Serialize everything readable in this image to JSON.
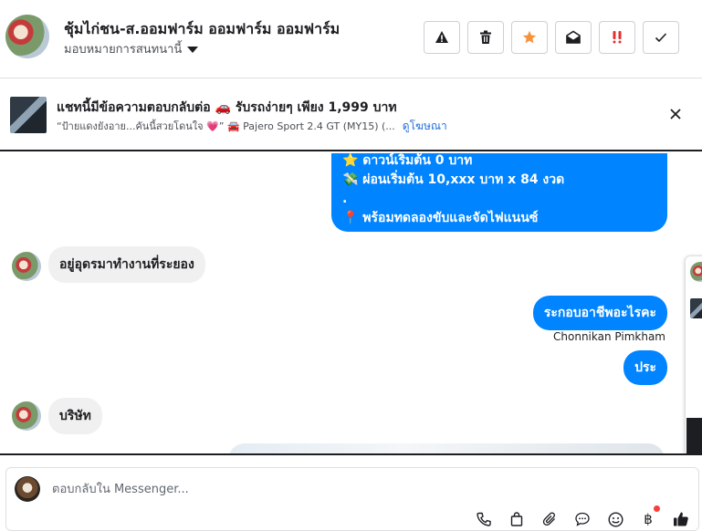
{
  "header": {
    "title": "ชุ้มไก่ชน-ส.ออมฟาร์ม ออมฟาร์ม ออมฟาร์ม",
    "assign_label": "มอบหมายการสนทนานี้"
  },
  "actions": [
    {
      "name": "spam-button",
      "icon": "alert-triangle-icon"
    },
    {
      "name": "delete-button",
      "icon": "trash-icon"
    },
    {
      "name": "star-button",
      "icon": "star-icon"
    },
    {
      "name": "mark-unread-button",
      "icon": "envelope-open-icon"
    },
    {
      "name": "follow-up-button",
      "icon": "double-exclamation-icon"
    },
    {
      "name": "done-button",
      "icon": "checkmark-icon"
    }
  ],
  "ad": {
    "title": "แชทนี้มีข้อความตอบกลับต่อ 🚗 รับรถง่ายๆ เพียง 1,999 บาท",
    "subtitle": "“ป้ายแดงยังอาย...คันนี้สวยโดนใจ 💗” 🚘 Pajero Sport 2.4 GT (MY15) (...",
    "link": "ดูโฆษณา"
  },
  "messages": {
    "out_block": {
      "line1": "⭐ ดาวน์เริ่มต้น 0 บาท",
      "line2": "💸 ผ่อนเริ่มต้น 10,xxx บาท x 84 งวด",
      "line3": ".",
      "line4": "📍 พร้อมทดลองขับและจัดไฟแนนซ์"
    },
    "in1": "อยู่อุดรมาทำงานที่ระยอง",
    "out1": "ระกอบอาชีพอะไรคะ",
    "sender_name": "Chonnikan Pimkham",
    "out2": "ประ",
    "in2": "บริษัท"
  },
  "reply": {
    "placeholder": "ตอบกลับใน Messenger..."
  },
  "tools": [
    {
      "name": "phone-icon"
    },
    {
      "name": "shopping-bag-icon"
    },
    {
      "name": "paperclip-icon"
    },
    {
      "name": "chat-bubble-icon"
    },
    {
      "name": "emoji-icon"
    },
    {
      "name": "baht-icon"
    },
    {
      "name": "thumbs-up-icon"
    }
  ],
  "colors": {
    "accent": "#0084ff",
    "incoming_bubble": "#f1f0f0",
    "star": "#f7923b",
    "follow_up": "#e03131"
  }
}
